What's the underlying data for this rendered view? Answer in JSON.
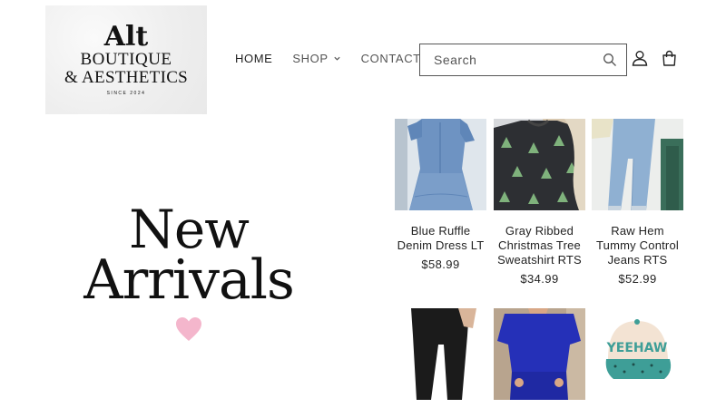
{
  "logo": {
    "line1": "Alt",
    "line2": "BOUTIQUE",
    "line3": "& AESTHETICS",
    "line4": "SINCE 2024"
  },
  "nav": {
    "items": [
      {
        "label": "HOME"
      },
      {
        "label": "SHOP"
      },
      {
        "label": "CONTACT"
      }
    ]
  },
  "search": {
    "placeholder": "Search"
  },
  "hero": {
    "line1": "New",
    "line2": "Arrivals"
  },
  "products": [
    {
      "name": "Blue Ruffle Denim Dress LT",
      "price": "$58.99"
    },
    {
      "name": "Gray Ribbed Christmas Tree Sweatshirt RTS",
      "price": "$34.99"
    },
    {
      "name": "Raw Hem Tummy Control Jeans RTS",
      "price": "$52.99"
    },
    {
      "name": "",
      "price": ""
    },
    {
      "name": "",
      "price": ""
    },
    {
      "name": "",
      "price": ""
    }
  ],
  "hat_text": "YEEHAW",
  "colors": {
    "heart": "#f4b6cc",
    "denim": "#6e93c2",
    "sweater": "#2d2f33",
    "royal_blue": "#2530b8",
    "hat_turquoise": "#3e9e97"
  }
}
